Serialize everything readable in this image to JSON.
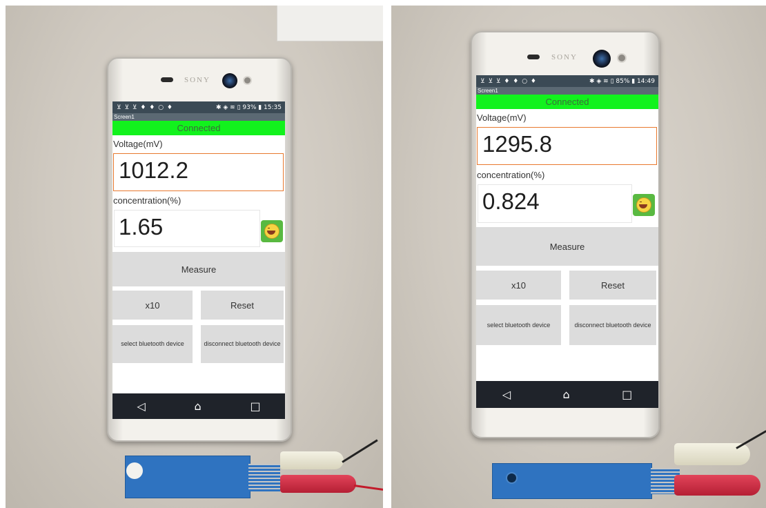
{
  "shared": {
    "brand": "SONY",
    "screen_title": "Screen1",
    "connection_status": "Connected",
    "voltage_label": "Voltage(mV)",
    "concentration_label": "concentration(%)",
    "measure_label": "Measure",
    "x10_label": "x10",
    "reset_label": "Reset",
    "select_bt_label": "select bluetooth device",
    "disconnect_bt_label": "disconnect bluetooth device",
    "nav_back": "◁",
    "nav_home": "⌂",
    "nav_recent": "□"
  },
  "left_phone": {
    "status_icons": "⊻ ⊻ ⊻ ♦ ♦ ○ ♦",
    "status_right": "✱ ◈ ≋ ▯ 93% ▮ 15:35",
    "voltage_value": "1012.2",
    "concentration_value": "1.65"
  },
  "right_phone": {
    "status_icons": "⊻ ⊻ ⊻ ♦ ♦ ○ ♦",
    "status_right": "✱ ◈ ≋ ▯ 85% ▮ 14:49",
    "voltage_value": "1295.8",
    "concentration_value": "0.824"
  },
  "colors": {
    "connected_bar": "#12f21d",
    "voltage_border": "#e8782d",
    "emoji_bg": "#59b941",
    "status_bar": "#3b4a55",
    "nav_bar": "#1f232a",
    "sensor_strip": "#2f73c0"
  },
  "icons": [
    "speaker-icon",
    "camera-icon",
    "emoji-smile-icon",
    "back-icon",
    "home-icon",
    "recent-apps-icon"
  ]
}
